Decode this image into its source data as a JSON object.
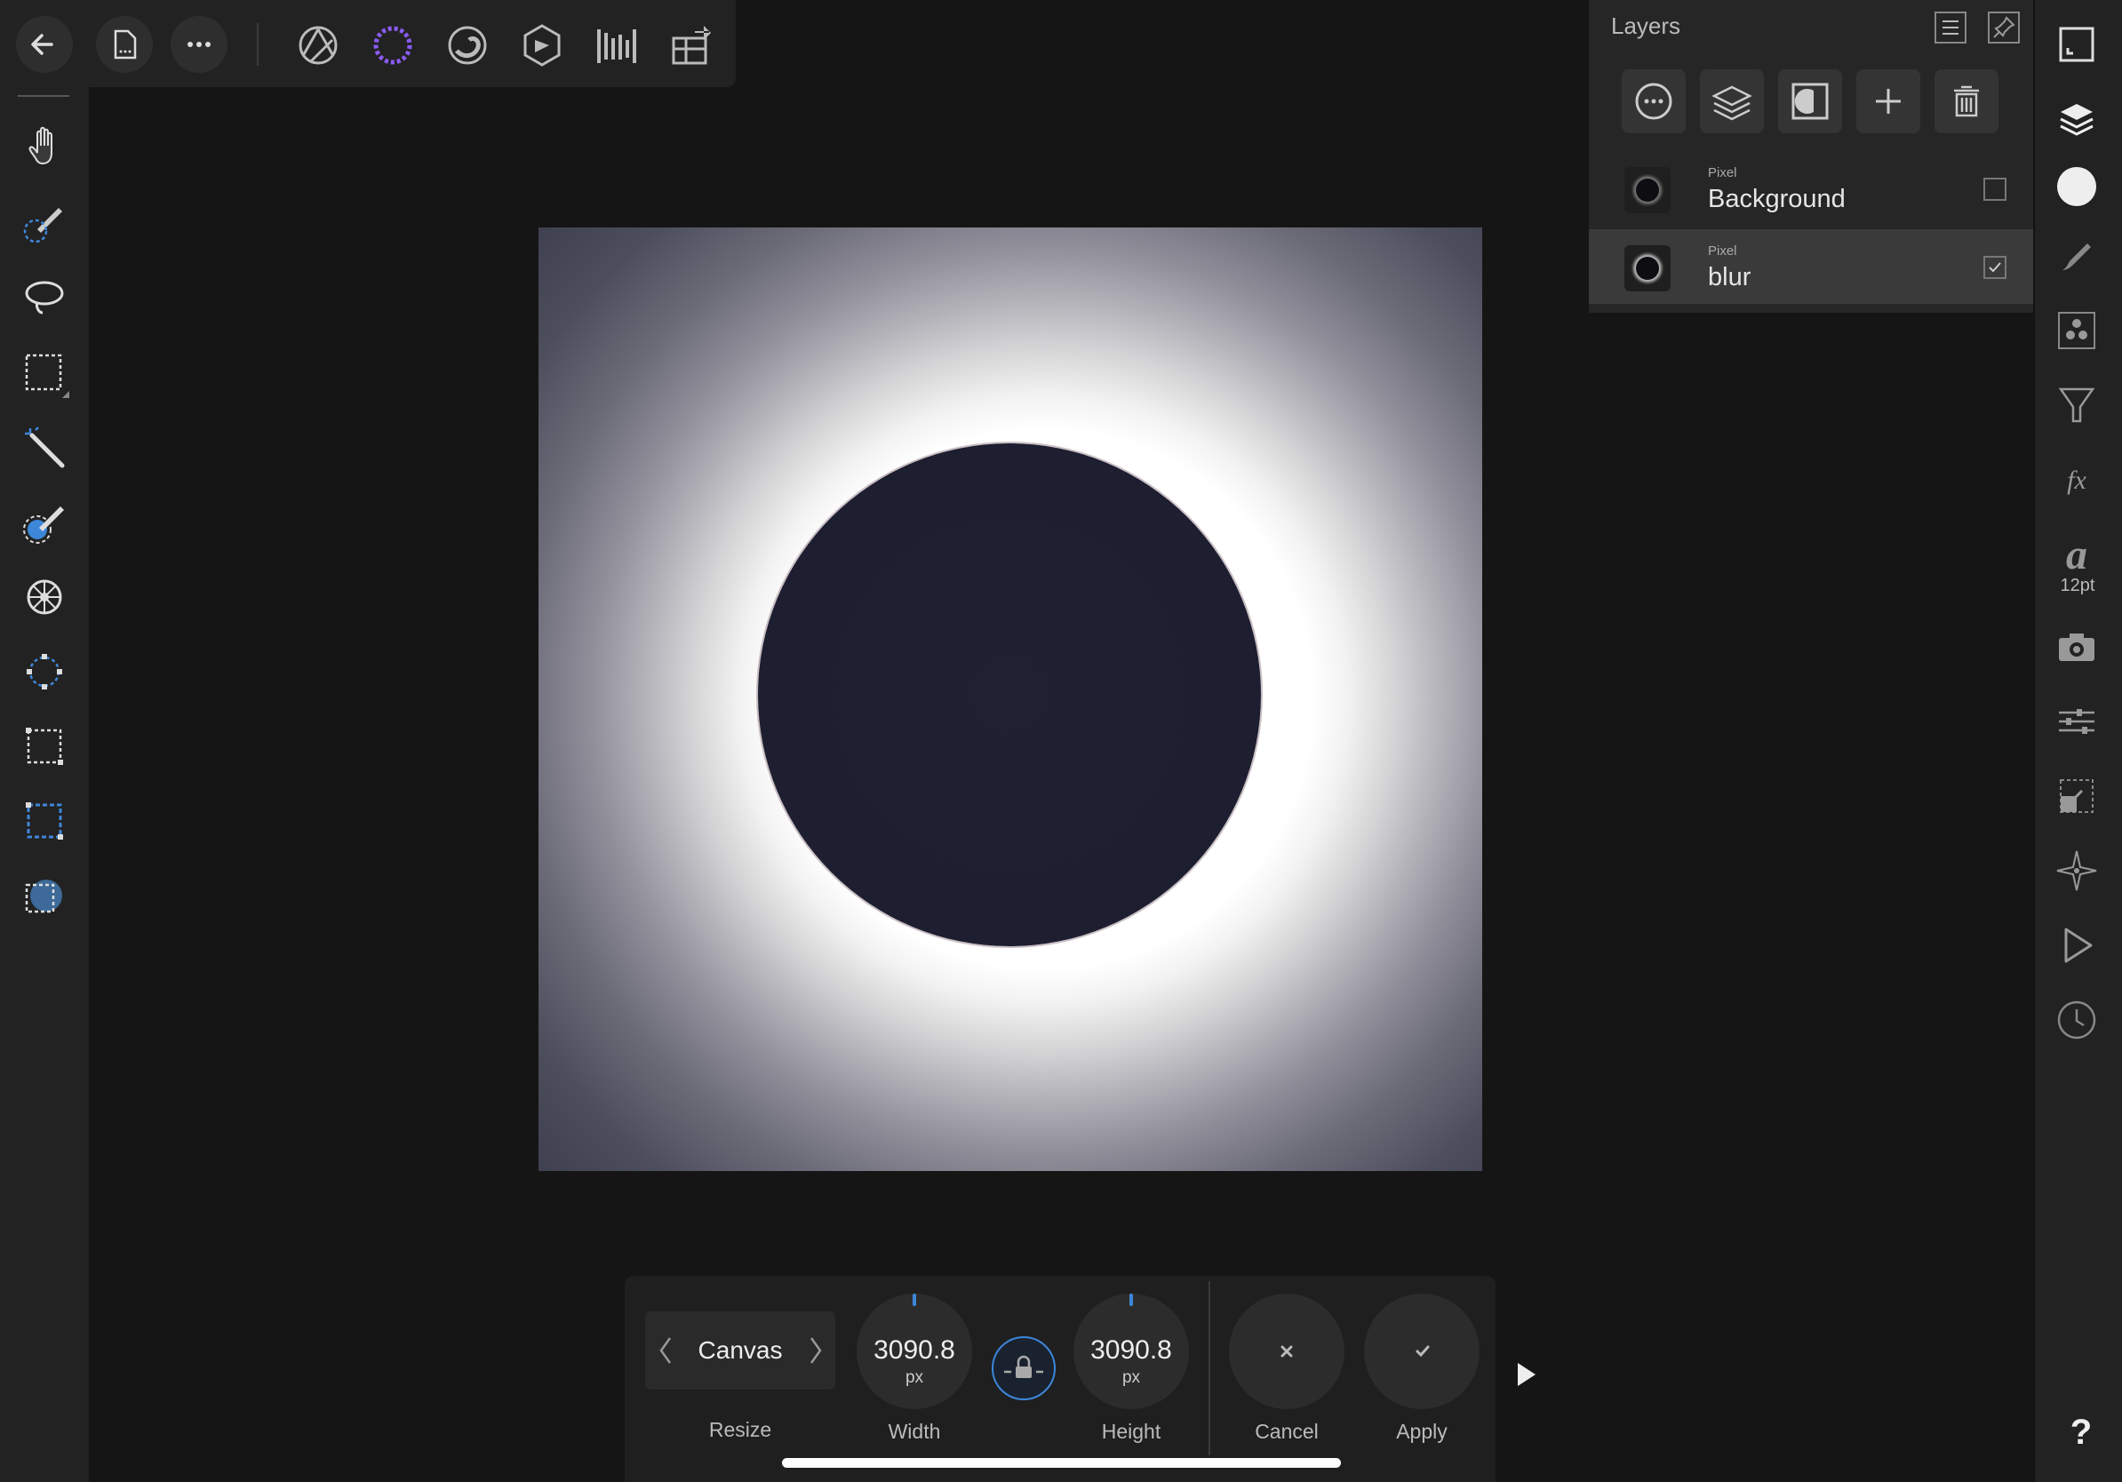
{
  "toolbar": {
    "back": "back-icon",
    "document": "document-icon",
    "more": "more-icon",
    "personas": [
      "photo-persona-icon",
      "selection-persona-icon",
      "liquify-persona-icon",
      "develop-persona-icon",
      "tone-mapping-persona-icon",
      "export-persona-icon"
    ]
  },
  "left_tools": [
    "view-hand-tool",
    "selection-brush-tool",
    "freehand-selection-tool",
    "marquee-selection-tool",
    "magic-wand-tool",
    "flood-select-tool",
    "radial-gradient-tool",
    "transform-tool",
    "crop-tool",
    "rectangle-selection-tool",
    "ellipse-shape-tool"
  ],
  "layers_panel": {
    "title": "Layers",
    "layers": [
      {
        "type": "Pixel",
        "name": "Background",
        "visible": false
      },
      {
        "type": "Pixel",
        "name": "blur",
        "visible": true
      }
    ]
  },
  "right_tools": {
    "font_size": "12pt"
  },
  "context_toolbar": {
    "mode": "Canvas",
    "mode_caption": "Resize",
    "width": {
      "value": "3090.8",
      "unit": "px",
      "label": "Width"
    },
    "height": {
      "value": "3090.8",
      "unit": "px",
      "label": "Height"
    },
    "cancel_label": "Cancel",
    "apply_label": "Apply"
  },
  "help_label": "?",
  "colors": {
    "accent": "#3d87d9",
    "panel": "#262626",
    "toolbar": "#222222"
  }
}
